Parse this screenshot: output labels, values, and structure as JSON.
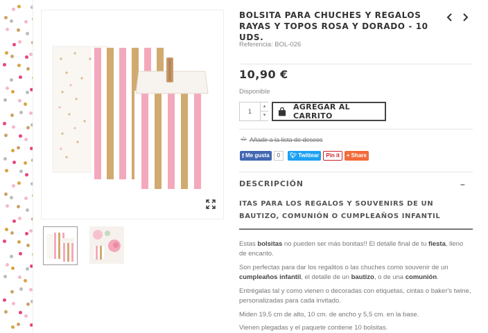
{
  "product": {
    "title": "BOLSITA PARA CHUCHES Y REGALOS RAYAS Y TOPOS ROSA Y DORADO - 10 UDS.",
    "reference_label": "Referencia:",
    "reference_value": "BOL-026",
    "price": "10,90 €",
    "availability": "Disponible",
    "quantity": "1"
  },
  "nav": {
    "prev_icon": "chevron-left-icon",
    "next_icon": "chevron-right-icon"
  },
  "actions": {
    "add_to_cart": "AGREGAR AL CARRITO",
    "wishlist": "Añadir a la lista de deseos"
  },
  "share": {
    "facebook_label": "Me gusta",
    "facebook_count": "0",
    "twitter_label": "Twittear",
    "pinterest_label": "Pin it",
    "share_label": "Share"
  },
  "description": {
    "heading": "DESCRIPCIÓN",
    "toggle": "–",
    "subheading": "ITAS PARA LOS REGALOS Y SOUVENIRS DE UN BAUTIZO, COMUNIÓN O CUMPLEAÑOS INFANTIL",
    "p1": {
      "a": "Estas ",
      "b": "bolsitas",
      "c": " no pueden ser más bonitas!! El detalle final de tu ",
      "d": "fiesta",
      "e": ", lleno de encanto."
    },
    "p2": {
      "a": "Son perfectas para dar los regalitos o las chuches como souvenir de un ",
      "b": "cumpleaños infantil",
      "c": ", el detalle de un ",
      "d": "bautizo",
      "e": ", o de una ",
      "f": "comunión",
      "g": "."
    },
    "p3": "Entrégalas tal y como vienen o decoradas con etiquetas, cintas o baker's twine, personalizadas para cada invitado.",
    "p4": "Miden 19,5 cm de alto, 10 cm. de ancho y 5,5 cm. en la base.",
    "p5": "Vienen plegadas y el paquete contiene 10 bolsitas."
  },
  "colors": {
    "pink": "#f4a7b9",
    "gold": "#c9a46a",
    "hot_pink": "#e8457a",
    "facebook": "#4267b2",
    "twitter": "#1da1f2"
  }
}
